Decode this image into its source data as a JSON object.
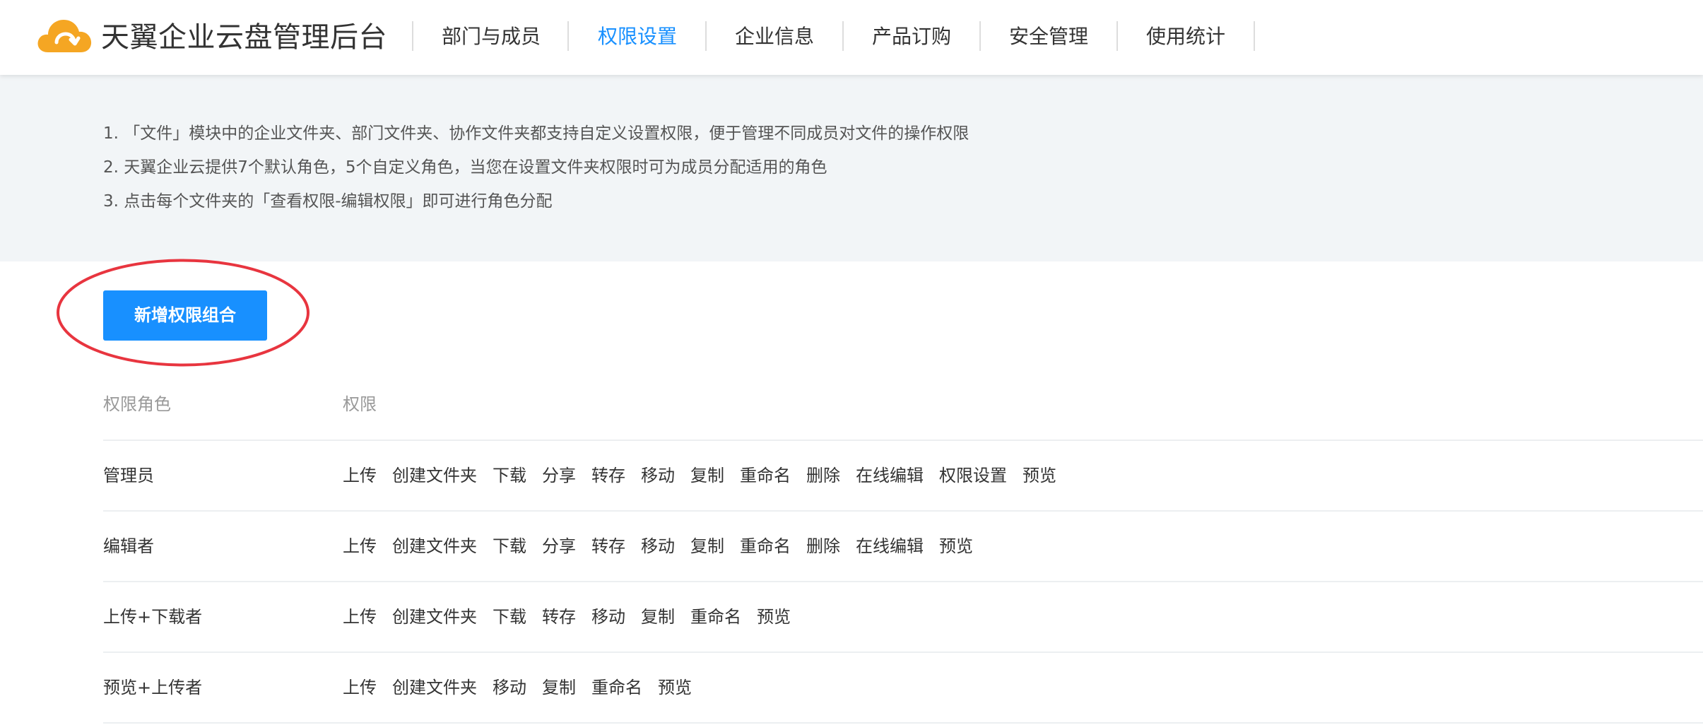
{
  "header": {
    "brand": "天翼企业云盘管理后台",
    "nav": [
      {
        "label": "部门与成员",
        "active": false
      },
      {
        "label": "权限设置",
        "active": true
      },
      {
        "label": "企业信息",
        "active": false
      },
      {
        "label": "产品订购",
        "active": false
      },
      {
        "label": "安全管理",
        "active": false
      },
      {
        "label": "使用统计",
        "active": false
      }
    ]
  },
  "notice": {
    "lines": [
      "1. 「文件」模块中的企业文件夹、部门文件夹、协作文件夹都支持自定义设置权限，便于管理不同成员对文件的操作权限",
      "2. 天翼企业云提供7个默认角色，5个自定义角色，当您在设置文件夹权限时可为成员分配适用的角色",
      "3. 点击每个文件夹的「查看权限-编辑权限」即可进行角色分配"
    ]
  },
  "add_button": {
    "label": "新增权限组合"
  },
  "table": {
    "headers": {
      "role": "权限角色",
      "permissions": "权限"
    },
    "rows": [
      {
        "role": "管理员",
        "permissions": [
          "上传",
          "创建文件夹",
          "下载",
          "分享",
          "转存",
          "移动",
          "复制",
          "重命名",
          "删除",
          "在线编辑",
          "权限设置",
          "预览"
        ]
      },
      {
        "role": "编辑者",
        "permissions": [
          "上传",
          "创建文件夹",
          "下载",
          "分享",
          "转存",
          "移动",
          "复制",
          "重命名",
          "删除",
          "在线编辑",
          "预览"
        ]
      },
      {
        "role": "上传+下载者",
        "permissions": [
          "上传",
          "创建文件夹",
          "下载",
          "转存",
          "移动",
          "复制",
          "重命名",
          "预览"
        ]
      },
      {
        "role": "预览+上传者",
        "permissions": [
          "上传",
          "创建文件夹",
          "移动",
          "复制",
          "重命名",
          "预览"
        ]
      }
    ]
  },
  "colors": {
    "accent": "#1890ff",
    "annotation": "#e8353f",
    "notice_bg": "#f2f5f7",
    "logo_orange": "#f5a623"
  }
}
